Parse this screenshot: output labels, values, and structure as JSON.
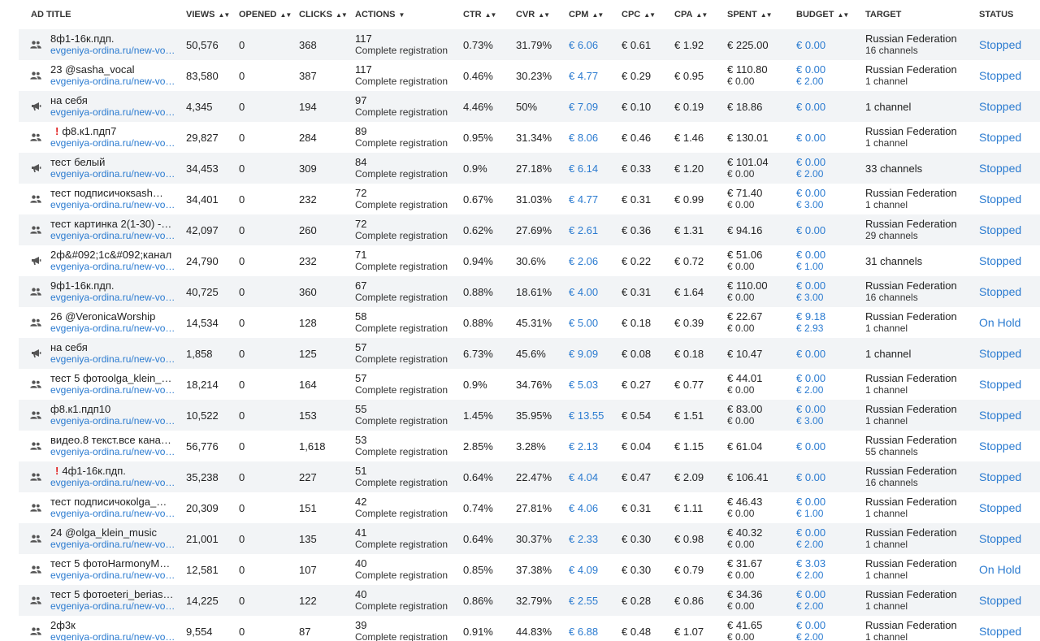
{
  "header": {
    "title": "AD TITLE",
    "views": "VIEWS",
    "opened": "OPENED",
    "clicks": "CLICKS",
    "actions": "ACTIONS",
    "ctr": "CTR",
    "cvr": "CVR",
    "cpm": "CPM",
    "cpc": "CPC",
    "cpa": "CPA",
    "spent": "SPENT",
    "budget": "BUDGET",
    "target": "TARGET",
    "status": "STATUS"
  },
  "colors": {
    "link": "#2b7bd0",
    "warning": "#e02020",
    "row_alt": "#f2f4f6"
  },
  "rows": [
    {
      "icon": "people-icon",
      "warning": false,
      "title": "8ф1-16к.пдп.",
      "url": "evgeniya-ordina.ru/new-vo…",
      "views": "50,576",
      "opened": "0",
      "clicks": "368",
      "actions": "117",
      "action_type": "Complete registration",
      "ctr": "0.73%",
      "cvr": "31.79%",
      "cpm": "€ 6.06",
      "cpc": "€ 0.61",
      "cpa": "€ 1.92",
      "spent": "€ 225.00",
      "spent2": "",
      "budget": "€ 0.00",
      "budget2": "",
      "target": "Russian Federation",
      "target2": "16 channels",
      "status": "Stopped"
    },
    {
      "icon": "people-icon",
      "warning": false,
      "title": "23 @sasha_vocal",
      "url": "evgeniya-ordina.ru/new-vo…",
      "views": "83,580",
      "opened": "0",
      "clicks": "387",
      "actions": "117",
      "action_type": "Complete registration",
      "ctr": "0.46%",
      "cvr": "30.23%",
      "cpm": "€ 4.77",
      "cpc": "€ 0.29",
      "cpa": "€ 0.95",
      "spent": "€ 110.80",
      "spent2": "€ 0.00",
      "budget": "€ 0.00",
      "budget2": "€ 2.00",
      "target": "Russian Federation",
      "target2": "1 channel",
      "status": "Stopped"
    },
    {
      "icon": "megaphone-icon",
      "warning": false,
      "title": "на себя",
      "url": "evgeniya-ordina.ru/new-vo…",
      "views": "4,345",
      "opened": "0",
      "clicks": "194",
      "actions": "97",
      "action_type": "Complete registration",
      "ctr": "4.46%",
      "cvr": "50%",
      "cpm": "€ 7.09",
      "cpc": "€ 0.10",
      "cpa": "€ 0.19",
      "spent": "€ 18.86",
      "spent2": "",
      "budget": "€ 0.00",
      "budget2": "",
      "target": "1 channel",
      "target2": "",
      "status": "Stopped"
    },
    {
      "icon": "people-icon",
      "warning": true,
      "title": "ф8.к1.пдп7",
      "url": "evgeniya-ordina.ru/new-vo…",
      "views": "29,827",
      "opened": "0",
      "clicks": "284",
      "actions": "89",
      "action_type": "Complete registration",
      "ctr": "0.95%",
      "cvr": "31.34%",
      "cpm": "€ 8.06",
      "cpc": "€ 0.46",
      "cpa": "€ 1.46",
      "spent": "€ 130.01",
      "spent2": "",
      "budget": "€ 0.00",
      "budget2": "",
      "target": "Russian Federation",
      "target2": "1 channel",
      "status": "Stopped"
    },
    {
      "icon": "megaphone-icon",
      "warning": false,
      "title": "тест белый",
      "url": "evgeniya-ordina.ru/new-vo…",
      "views": "34,453",
      "opened": "0",
      "clicks": "309",
      "actions": "84",
      "action_type": "Complete registration",
      "ctr": "0.9%",
      "cvr": "27.18%",
      "cpm": "€ 6.14",
      "cpc": "€ 0.33",
      "cpa": "€ 1.20",
      "spent": "€ 101.04",
      "spent2": "€ 0.00",
      "budget": "€ 0.00",
      "budget2": "€ 2.00",
      "target": "33 channels",
      "target2": "",
      "status": "Stopped"
    },
    {
      "icon": "people-icon",
      "warning": false,
      "title": "тест подписичокsash…",
      "url": "evgeniya-ordina.ru/new-vo…",
      "views": "34,401",
      "opened": "0",
      "clicks": "232",
      "actions": "72",
      "action_type": "Complete registration",
      "ctr": "0.67%",
      "cvr": "31.03%",
      "cpm": "€ 4.77",
      "cpc": "€ 0.31",
      "cpa": "€ 0.99",
      "spent": "€ 71.40",
      "spent2": "€ 0.00",
      "budget": "€ 0.00",
      "budget2": "€ 3.00",
      "target": "Russian Federation",
      "target2": "1 channel",
      "status": "Stopped"
    },
    {
      "icon": "people-icon",
      "warning": false,
      "title": "тест картинка 2(1-30) -…",
      "url": "evgeniya-ordina.ru/new-vo…",
      "views": "42,097",
      "opened": "0",
      "clicks": "260",
      "actions": "72",
      "action_type": "Complete registration",
      "ctr": "0.62%",
      "cvr": "27.69%",
      "cpm": "€ 2.61",
      "cpc": "€ 0.36",
      "cpa": "€ 1.31",
      "spent": "€ 94.16",
      "spent2": "",
      "budget": "€ 0.00",
      "budget2": "",
      "target": "Russian Federation",
      "target2": "29 channels",
      "status": "Stopped"
    },
    {
      "icon": "megaphone-icon",
      "warning": false,
      "title": "2ф&#092;1с&#092;канал",
      "url": "evgeniya-ordina.ru/new-vo…",
      "views": "24,790",
      "opened": "0",
      "clicks": "232",
      "actions": "71",
      "action_type": "Complete registration",
      "ctr": "0.94%",
      "cvr": "30.6%",
      "cpm": "€ 2.06",
      "cpc": "€ 0.22",
      "cpa": "€ 0.72",
      "spent": "€ 51.06",
      "spent2": "€ 0.00",
      "budget": "€ 0.00",
      "budget2": "€ 1.00",
      "target": "31 channels",
      "target2": "",
      "status": "Stopped"
    },
    {
      "icon": "people-icon",
      "warning": false,
      "title": "9ф1-16к.пдп.",
      "url": "evgeniya-ordina.ru/new-vo…",
      "views": "40,725",
      "opened": "0",
      "clicks": "360",
      "actions": "67",
      "action_type": "Complete registration",
      "ctr": "0.88%",
      "cvr": "18.61%",
      "cpm": "€ 4.00",
      "cpc": "€ 0.31",
      "cpa": "€ 1.64",
      "spent": "€ 110.00",
      "spent2": "€ 0.00",
      "budget": "€ 0.00",
      "budget2": "€ 3.00",
      "target": "Russian Federation",
      "target2": "16 channels",
      "status": "Stopped"
    },
    {
      "icon": "people-icon",
      "warning": false,
      "title": "26 @VeronicaWorship",
      "url": "evgeniya-ordina.ru/new-vo…",
      "views": "14,534",
      "opened": "0",
      "clicks": "128",
      "actions": "58",
      "action_type": "Complete registration",
      "ctr": "0.88%",
      "cvr": "45.31%",
      "cpm": "€ 5.00",
      "cpc": "€ 0.18",
      "cpa": "€ 0.39",
      "spent": "€ 22.67",
      "spent2": "€ 0.00",
      "budget": "€ 9.18",
      "budget2": "€ 2.93",
      "target": "Russian Federation",
      "target2": "1 channel",
      "status": "On Hold"
    },
    {
      "icon": "megaphone-icon",
      "warning": false,
      "title": "на себя",
      "url": "evgeniya-ordina.ru/new-vo…",
      "views": "1,858",
      "opened": "0",
      "clicks": "125",
      "actions": "57",
      "action_type": "Complete registration",
      "ctr": "6.73%",
      "cvr": "45.6%",
      "cpm": "€ 9.09",
      "cpc": "€ 0.08",
      "cpa": "€ 0.18",
      "spent": "€ 10.47",
      "spent2": "",
      "budget": "€ 0.00",
      "budget2": "",
      "target": "1 channel",
      "target2": "",
      "status": "Stopped"
    },
    {
      "icon": "people-icon",
      "warning": false,
      "title": "тест 5 фотоolga_klein_…",
      "url": "evgeniya-ordina.ru/new-vo…",
      "views": "18,214",
      "opened": "0",
      "clicks": "164",
      "actions": "57",
      "action_type": "Complete registration",
      "ctr": "0.9%",
      "cvr": "34.76%",
      "cpm": "€ 5.03",
      "cpc": "€ 0.27",
      "cpa": "€ 0.77",
      "spent": "€ 44.01",
      "spent2": "€ 0.00",
      "budget": "€ 0.00",
      "budget2": "€ 2.00",
      "target": "Russian Federation",
      "target2": "1 channel",
      "status": "Stopped"
    },
    {
      "icon": "people-icon",
      "warning": false,
      "title": "ф8.к1.пдп10",
      "url": "evgeniya-ordina.ru/new-vo…",
      "views": "10,522",
      "opened": "0",
      "clicks": "153",
      "actions": "55",
      "action_type": "Complete registration",
      "ctr": "1.45%",
      "cvr": "35.95%",
      "cpm": "€ 13.55",
      "cpc": "€ 0.54",
      "cpa": "€ 1.51",
      "spent": "€ 83.00",
      "spent2": "€ 0.00",
      "budget": "€ 0.00",
      "budget2": "€ 3.00",
      "target": "Russian Federation",
      "target2": "1 channel",
      "status": "Stopped"
    },
    {
      "icon": "people-icon",
      "warning": false,
      "title": "видео.8 текст.все кана…",
      "url": "evgeniya-ordina.ru/new-vo…",
      "views": "56,776",
      "opened": "0",
      "clicks": "1,618",
      "actions": "53",
      "action_type": "Complete registration",
      "ctr": "2.85%",
      "cvr": "3.28%",
      "cpm": "€ 2.13",
      "cpc": "€ 0.04",
      "cpa": "€ 1.15",
      "spent": "€ 61.04",
      "spent2": "",
      "budget": "€ 0.00",
      "budget2": "",
      "target": "Russian Federation",
      "target2": "55 channels",
      "status": "Stopped"
    },
    {
      "icon": "people-icon",
      "warning": true,
      "title": "4ф1-16к.пдп.",
      "url": "evgeniya-ordina.ru/new-vo…",
      "views": "35,238",
      "opened": "0",
      "clicks": "227",
      "actions": "51",
      "action_type": "Complete registration",
      "ctr": "0.64%",
      "cvr": "22.47%",
      "cpm": "€ 4.04",
      "cpc": "€ 0.47",
      "cpa": "€ 2.09",
      "spent": "€ 106.41",
      "spent2": "",
      "budget": "€ 0.00",
      "budget2": "",
      "target": "Russian Federation",
      "target2": "16 channels",
      "status": "Stopped"
    },
    {
      "icon": "people-icon",
      "warning": false,
      "title": "тест подписичокolga_…",
      "url": "evgeniya-ordina.ru/new-vo…",
      "views": "20,309",
      "opened": "0",
      "clicks": "151",
      "actions": "42",
      "action_type": "Complete registration",
      "ctr": "0.74%",
      "cvr": "27.81%",
      "cpm": "€ 4.06",
      "cpc": "€ 0.31",
      "cpa": "€ 1.11",
      "spent": "€ 46.43",
      "spent2": "€ 0.00",
      "budget": "€ 0.00",
      "budget2": "€ 1.00",
      "target": "Russian Federation",
      "target2": "1 channel",
      "status": "Stopped"
    },
    {
      "icon": "people-icon",
      "warning": false,
      "title": "24 @olga_klein_music",
      "url": "evgeniya-ordina.ru/new-vo…",
      "views": "21,001",
      "opened": "0",
      "clicks": "135",
      "actions": "41",
      "action_type": "Complete registration",
      "ctr": "0.64%",
      "cvr": "30.37%",
      "cpm": "€ 2.33",
      "cpc": "€ 0.30",
      "cpa": "€ 0.98",
      "spent": "€ 40.32",
      "spent2": "€ 0.00",
      "budget": "€ 0.00",
      "budget2": "€ 2.00",
      "target": "Russian Federation",
      "target2": "1 channel",
      "status": "Stopped"
    },
    {
      "icon": "people-icon",
      "warning": false,
      "title": "тест 5 фотоHarmonyM…",
      "url": "evgeniya-ordina.ru/new-vo…",
      "views": "12,581",
      "opened": "0",
      "clicks": "107",
      "actions": "40",
      "action_type": "Complete registration",
      "ctr": "0.85%",
      "cvr": "37.38%",
      "cpm": "€ 4.09",
      "cpc": "€ 0.30",
      "cpa": "€ 0.79",
      "spent": "€ 31.67",
      "spent2": "€ 0.00",
      "budget": "€ 3.03",
      "budget2": "€ 2.00",
      "target": "Russian Federation",
      "target2": "1 channel",
      "status": "On Hold"
    },
    {
      "icon": "people-icon",
      "warning": false,
      "title": "тест 5 фотоeteri_berias…",
      "url": "evgeniya-ordina.ru/new-vo…",
      "views": "14,225",
      "opened": "0",
      "clicks": "122",
      "actions": "40",
      "action_type": "Complete registration",
      "ctr": "0.86%",
      "cvr": "32.79%",
      "cpm": "€ 2.55",
      "cpc": "€ 0.28",
      "cpa": "€ 0.86",
      "spent": "€ 34.36",
      "spent2": "€ 0.00",
      "budget": "€ 0.00",
      "budget2": "€ 2.00",
      "target": "Russian Federation",
      "target2": "1 channel",
      "status": "Stopped"
    },
    {
      "icon": "people-icon",
      "warning": false,
      "title": "2ф3к",
      "url": "evgeniya-ordina.ru/new-vo…",
      "views": "9,554",
      "opened": "0",
      "clicks": "87",
      "actions": "39",
      "action_type": "Complete registration",
      "ctr": "0.91%",
      "cvr": "44.83%",
      "cpm": "€ 6.88",
      "cpc": "€ 0.48",
      "cpa": "€ 1.07",
      "spent": "€ 41.65",
      "spent2": "€ 0.00",
      "budget": "€ 0.00",
      "budget2": "€ 2.00",
      "target": "Russian Federation",
      "target2": "1 channel",
      "status": "Stopped"
    }
  ]
}
